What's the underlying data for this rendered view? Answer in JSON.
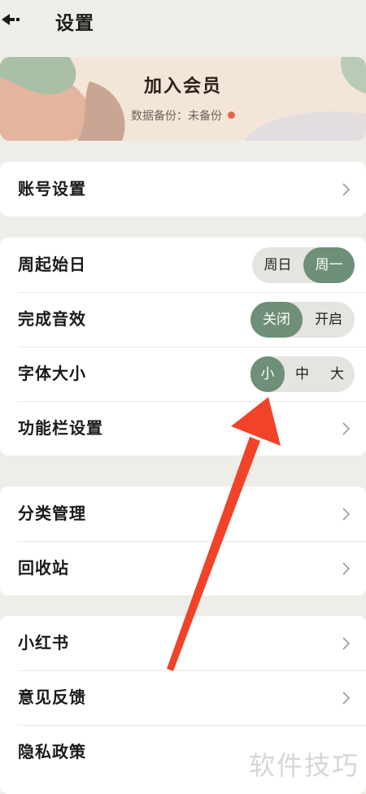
{
  "header": {
    "title": "设置",
    "back_icon": "back-arrow-icon"
  },
  "banner": {
    "title": "加入会员",
    "subtitle": "数据备份：未备份",
    "status_color": "#e4664a"
  },
  "sections": {
    "account": {
      "label": "账号设置"
    },
    "week_start": {
      "label": "周起始日",
      "options": [
        "周日",
        "周一"
      ],
      "selected": "周一"
    },
    "sound": {
      "label": "完成音效",
      "options": [
        "关闭",
        "开启"
      ],
      "selected": "关闭"
    },
    "font_size": {
      "label": "字体大小",
      "options": [
        "小",
        "中",
        "大"
      ],
      "selected": "小"
    },
    "toolbar": {
      "label": "功能栏设置"
    },
    "category": {
      "label": "分类管理"
    },
    "recycle": {
      "label": "回收站"
    },
    "xiaohongshu": {
      "label": "小红书"
    },
    "feedback": {
      "label": "意见反馈"
    },
    "privacy": {
      "label": "隐私政策"
    }
  },
  "annotation": {
    "color": "#f0432a"
  },
  "watermark": "软件技巧",
  "colors": {
    "accent": "#6e8f78",
    "background": "#efede8"
  }
}
